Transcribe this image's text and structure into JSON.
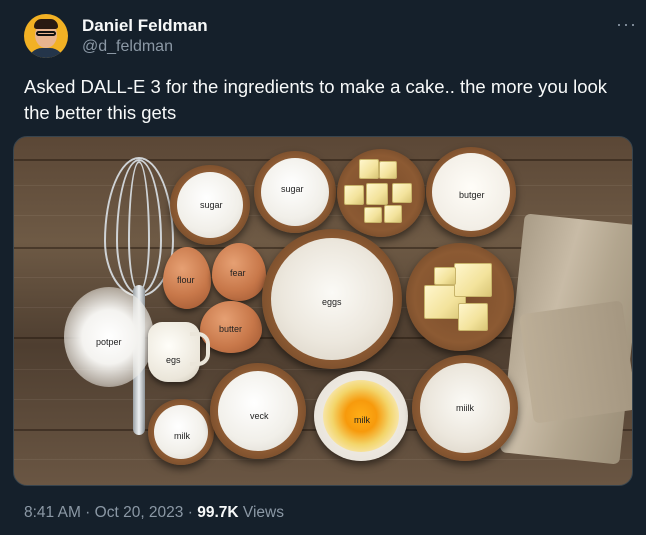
{
  "author": {
    "name": "Daniel Feldman",
    "handle": "@d_feldman"
  },
  "menu_icon": "more-horizontal-icon",
  "more_glyph": "···",
  "tweet": {
    "text": "Asked DALL-E 3 for the ingredients to make a cake.. the more you look the better this gets"
  },
  "image_labels": {
    "sugar_left": "sugar",
    "sugar_top": "sugar",
    "butger": "butger",
    "flour": "flour",
    "fear": "fear",
    "eggs": "eggs",
    "butter": "butter",
    "potper": "potper",
    "egs": "egs",
    "milk_small": "milk",
    "veck": "veck",
    "milk_yolk": "milk",
    "miilk": "miilk"
  },
  "footer": {
    "time": "8:41 AM",
    "sep1": " · ",
    "date": "Oct 20, 2023",
    "sep2": " · ",
    "views_count": "99.7K",
    "views_label": " Views"
  }
}
